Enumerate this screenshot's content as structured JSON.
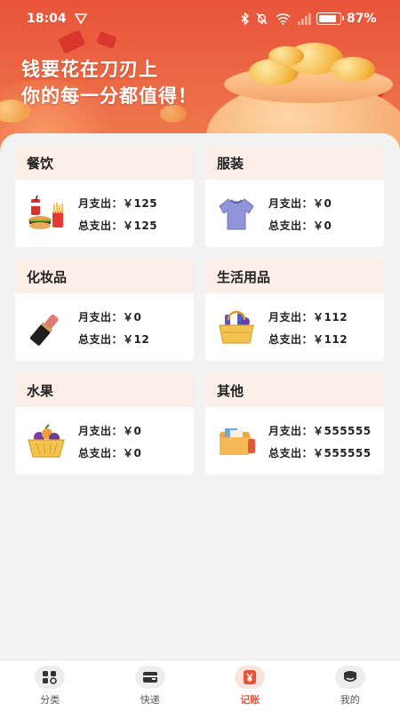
{
  "status_bar": {
    "time": "18:04",
    "battery_pct": "87%",
    "battery_level": 0.87
  },
  "hero": {
    "slogan_line1": "钱要花在刀刃上",
    "slogan_line2": "你的每一分都值得！"
  },
  "categories": [
    {
      "name": "餐饮",
      "icon": "fast-food-icon",
      "monthly": "月支出：￥125",
      "total": "总支出：￥125"
    },
    {
      "name": "服装",
      "icon": "tshirt-icon",
      "monthly": "月支出：￥0",
      "total": "总支出：￥0"
    },
    {
      "name": "化妆品",
      "icon": "lipstick-icon",
      "monthly": "月支出：￥0",
      "total": "总支出：￥12"
    },
    {
      "name": "生活用品",
      "icon": "basket-icon",
      "monthly": "月支出：￥112",
      "total": "总支出：￥112"
    },
    {
      "name": "水果",
      "icon": "fruit-basket-icon",
      "monthly": "月支出：￥0",
      "total": "总支出：￥0"
    },
    {
      "name": "其他",
      "icon": "folder-icon",
      "monthly": "月支出：￥555555",
      "total": "总支出：￥555555"
    }
  ],
  "bottom_nav": {
    "items": [
      {
        "label": "分类",
        "icon": "category-grid-icon",
        "active": false
      },
      {
        "label": "快递",
        "icon": "package-icon",
        "active": false
      },
      {
        "label": "记账",
        "icon": "ledger-yuan-icon",
        "active": true
      },
      {
        "label": "我的",
        "icon": "profile-icon",
        "active": false
      }
    ]
  },
  "colors": {
    "accent": "#e5533a",
    "card_header": "#fbeee6",
    "background": "#f2f2f2"
  }
}
